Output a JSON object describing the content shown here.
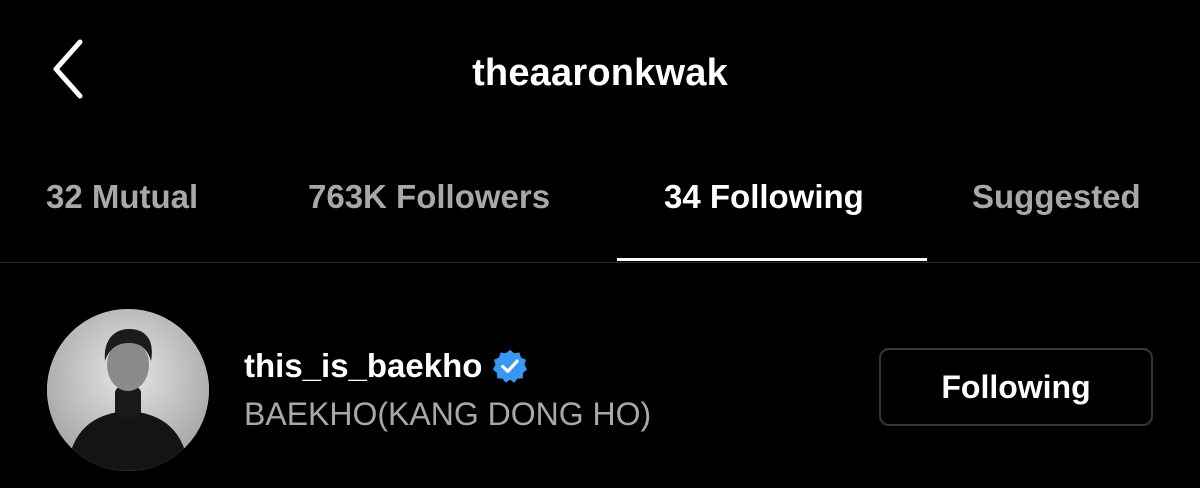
{
  "header": {
    "title": "theaaronkwak",
    "back_icon": "chevron-left-icon"
  },
  "tabs": [
    {
      "label": "32 Mutual",
      "active": false
    },
    {
      "label": "763K Followers",
      "active": false
    },
    {
      "label": "34 Following",
      "active": true
    },
    {
      "label": "Suggested",
      "active": false
    }
  ],
  "list": {
    "items": [
      {
        "username": "this_is_baekho",
        "verified": true,
        "full_name": "BAEKHO(KANG DONG HO)",
        "button_label": "Following"
      }
    ]
  },
  "colors": {
    "background": "#000000",
    "primary_text": "#ffffff",
    "secondary_text": "#a8a8a8",
    "verified_badge": "#3897f0",
    "divider": "#2a2a2a",
    "button_border": "#363636"
  }
}
